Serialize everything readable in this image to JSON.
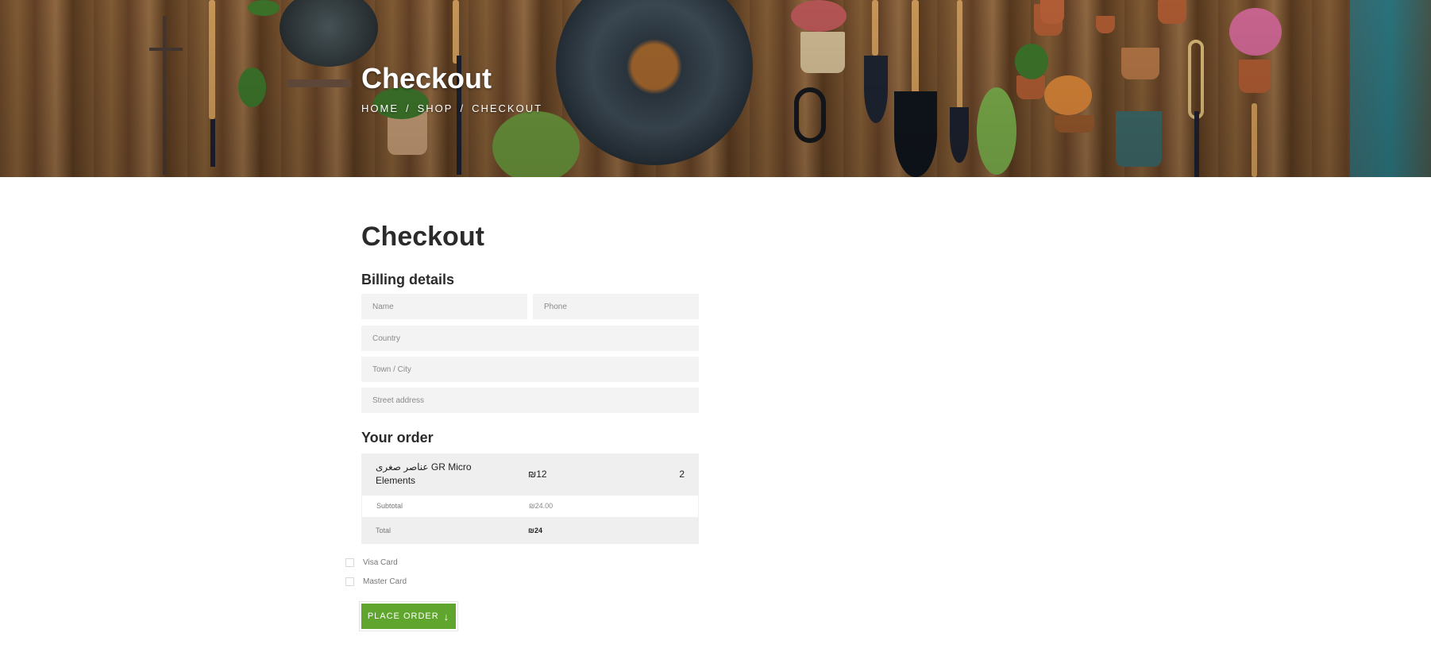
{
  "hero": {
    "title": "Checkout",
    "breadcrumb": [
      "HOME",
      "SHOP",
      "CHECKOUT"
    ],
    "separator": "/"
  },
  "page": {
    "title": "Checkout"
  },
  "billing": {
    "heading": "Billing details",
    "fields": {
      "name_placeholder": "Name",
      "phone_placeholder": "Phone",
      "country_placeholder": "Country",
      "city_placeholder": "Town / City",
      "street_placeholder": "Street address"
    }
  },
  "order": {
    "heading": "Your order",
    "product": {
      "name": "عناصر صغرى GR Micro Elements",
      "price": "₪12",
      "quantity": "2"
    },
    "subtotal_label": "Subtotal",
    "subtotal_value": "₪24.00",
    "total_label": "Total",
    "total_value": "₪24"
  },
  "payment": {
    "options": [
      "Visa Card",
      "Master Card"
    ]
  },
  "actions": {
    "place_order_label": "PLACE ORDER",
    "place_order_icon": "down-arrow-icon"
  },
  "colors": {
    "accent_green": "#5fa52e",
    "field_bg": "#f3f3f3",
    "row_bg": "#efefef"
  }
}
